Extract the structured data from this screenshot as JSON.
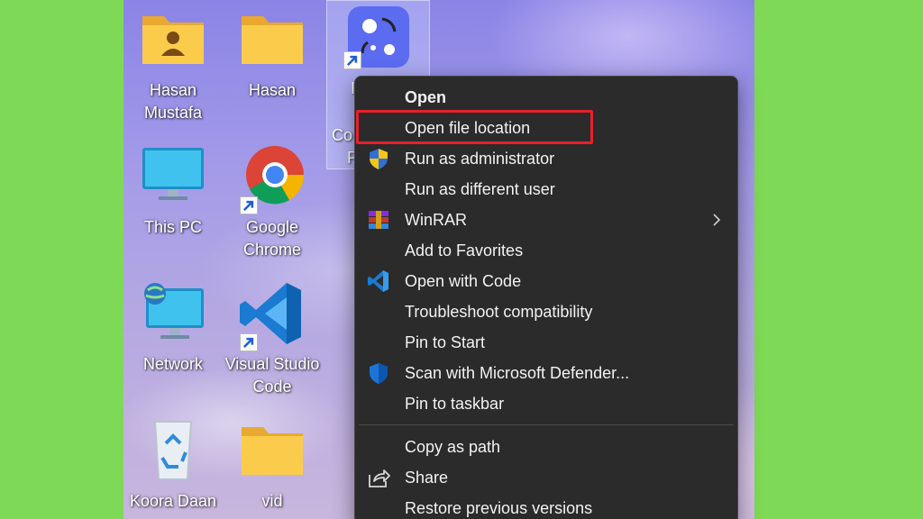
{
  "desktop": {
    "icons": [
      {
        "label_line1": "Hasan",
        "label_line2": "Mustafa",
        "kind": "user-folder-icon"
      },
      {
        "label_line1": "Hasan",
        "label_line2": "",
        "kind": "folder-icon"
      },
      {
        "label_line1": "This PC",
        "label_line2": "",
        "kind": "monitor-icon"
      },
      {
        "label_line1": "Google",
        "label_line2": "Chrome",
        "kind": "chrome-icon"
      },
      {
        "label_line1": "Network",
        "label_line2": "",
        "kind": "network-icon"
      },
      {
        "label_line1": "Visual Studio",
        "label_line2": "Code",
        "kind": "vscode-icon"
      },
      {
        "label_line1": "Koora Daan",
        "label_line2": "",
        "kind": "recycle-bin-icon"
      },
      {
        "label_line1": "vid",
        "label_line2": "",
        "kind": "folder-icon"
      }
    ],
    "selected_partial": {
      "line1": "I",
      "line2": "Co",
      "line3": "P"
    }
  },
  "context_menu": {
    "items": [
      {
        "label": "Open",
        "icon": ""
      },
      {
        "label": "Open file location",
        "icon": ""
      },
      {
        "label": "Run as administrator",
        "icon": "uac-shield-icon"
      },
      {
        "label": "Run as different user",
        "icon": ""
      },
      {
        "label": "WinRAR",
        "icon": "winrar-icon"
      },
      {
        "label": "Add to Favorites",
        "icon": ""
      },
      {
        "label": "Open with Code",
        "icon": "vscode-icon"
      },
      {
        "label": "Troubleshoot compatibility",
        "icon": ""
      },
      {
        "label": "Pin to Start",
        "icon": ""
      },
      {
        "label": "Scan with Microsoft Defender...",
        "icon": "defender-shield-icon"
      },
      {
        "label": "Pin to taskbar",
        "icon": ""
      },
      {
        "label": "Copy as path",
        "icon": ""
      },
      {
        "label": "Share",
        "icon": "share-icon"
      },
      {
        "label": "Restore previous versions",
        "icon": ""
      }
    ]
  },
  "colors": {
    "background": "#7ed957",
    "menu_bg": "#2b2b2b",
    "highlight": "#e8202a"
  }
}
